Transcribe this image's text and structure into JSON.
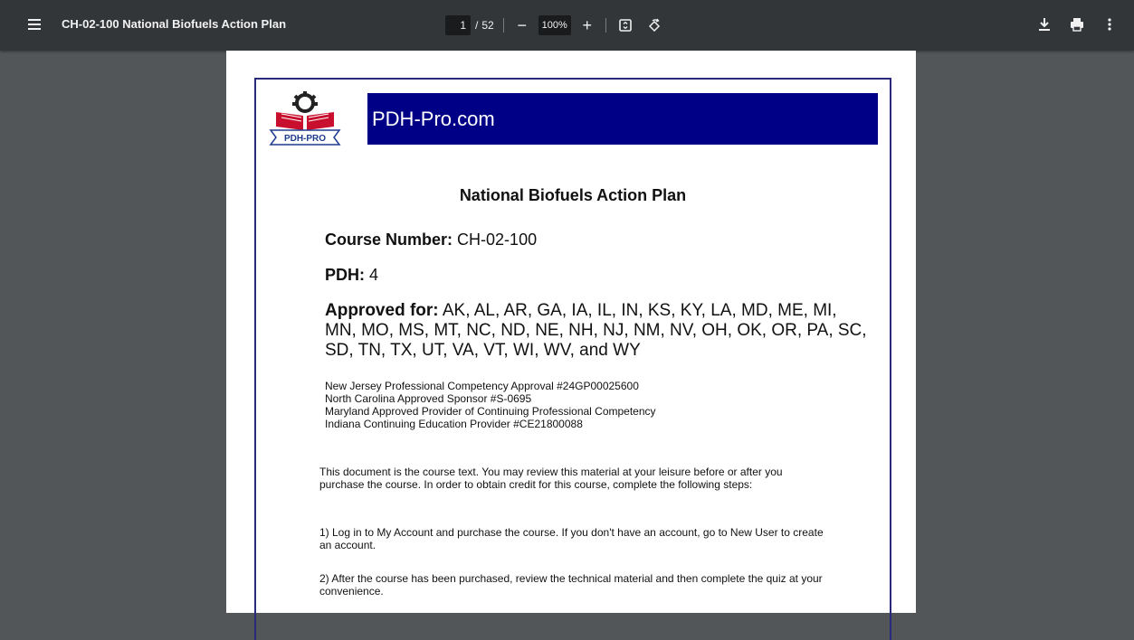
{
  "toolbar": {
    "title": "CH-02-100 National Biofuels Action Plan",
    "page_current": "1",
    "page_separator": "/",
    "page_total": "52",
    "zoom_out_label": "−",
    "zoom_value": "100%",
    "zoom_in_label": "+",
    "icons": [
      "menu-icon",
      "fit-page-icon",
      "rotate-icon",
      "download-icon",
      "print-icon",
      "more-icon"
    ]
  },
  "document": {
    "banner_text": "PDH-Pro.com",
    "logo_text": "PDH-PRO",
    "title": "National Biofuels Action Plan",
    "course_number_label": "Course Number:",
    "course_number_value": "CH-02-100",
    "pdh_label": "PDH:",
    "pdh_value": "4",
    "approved_label": "Approved for:",
    "approved_value": "AK, AL, AR, GA, IA, IL, IN, KS, KY, LA, MD, ME, MI, MN, MO, MS, MT, NC, ND, NE, NH, NJ, NM, NV, OH, OK, OR, PA, SC, SD, TN, TX, UT, VA, VT, WI, WV, and WY",
    "approvals": [
      "New Jersey Professional Competency Approval #24GP00025600",
      "North Carolina Approved Sponsor #S-0695",
      "Maryland Approved Provider of Continuing Professional Competency",
      "Indiana Continuing Education Provider #CE21800088"
    ],
    "paragraphs": [
      "This document is the course text. You may review this material at your leisure before or after you purchase the course. In order to obtain credit for this course, complete the following steps:",
      "1) Log in to My Account and purchase the course. If you don't have an account, go to New User to create an account.",
      "2) After the course has been purchased, review the technical material and then complete the quiz at your convenience."
    ]
  },
  "colors": {
    "toolbar_bg": "#323639",
    "viewer_bg": "#525659",
    "banner_bg": "#000087",
    "frame_border": "#2a2a7a",
    "logo_red": "#c8102e",
    "logo_blue": "#1f3c8c"
  }
}
